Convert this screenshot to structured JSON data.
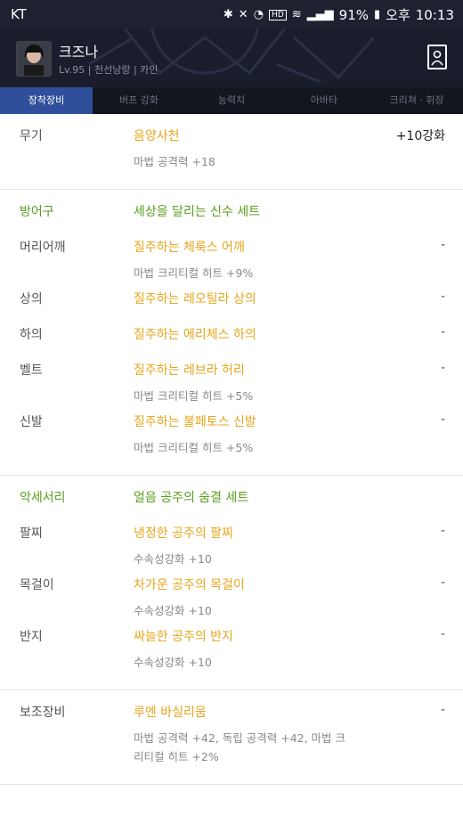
{
  "statusbar": {
    "carrier": "KT",
    "battery": "91%",
    "ampm": "오후",
    "time": "10:13"
  },
  "character": {
    "name": "크즈나",
    "level": "Lv.95",
    "class": "천선낭랑",
    "server": "카인"
  },
  "tabs": [
    "장착장비",
    "버프 강화",
    "능력치",
    "아바타",
    "크리쳐 · 휘장"
  ],
  "sections": [
    {
      "rows": [
        {
          "label": "무기",
          "name": "음양사천",
          "right": "+10강화",
          "stat": "마법 공격력 +18"
        }
      ]
    },
    {
      "rows": [
        {
          "label": "방어구",
          "name": "세상을 달리는 신수 세트",
          "group": true
        },
        {
          "label": "머리어깨",
          "name": "질주하는 체룩스 어깨",
          "right": "-",
          "stat": "마법 크리티컬 히트 +9%"
        },
        {
          "label": "상의",
          "name": "질주하는 레오틸라 상의",
          "right": "-"
        },
        {
          "label": "하의",
          "name": "질주하는 에리체스 하의",
          "right": "-"
        },
        {
          "label": "벨트",
          "name": "질주하는 레브라 허리",
          "right": "-",
          "stat": "마법 크리티컬 히트 +5%"
        },
        {
          "label": "신발",
          "name": "질주하는 불페토스 신발",
          "right": "-",
          "stat": "마법 크리티컬 히트 +5%"
        }
      ]
    },
    {
      "rows": [
        {
          "label": "악세서리",
          "name": "얼음 공주의 숨결 세트",
          "group": true
        },
        {
          "label": "팔찌",
          "name": "냉정한 공주의 팔찌",
          "right": "-",
          "stat": "수속성강화 +10"
        },
        {
          "label": "목걸이",
          "name": "차가운 공주의 목걸이",
          "right": "-",
          "stat": "수속성강화 +10"
        },
        {
          "label": "반지",
          "name": "싸늘한 공주의 반지",
          "right": "-",
          "stat": "수속성강화 +10"
        }
      ]
    },
    {
      "rows": [
        {
          "label": "보조장비",
          "name": "루멘 바실리움",
          "right": "-",
          "stat": "마법 공격력 +42, 독립 공격력 +42, 마법 크리티컬 히트 +2%"
        }
      ]
    }
  ]
}
